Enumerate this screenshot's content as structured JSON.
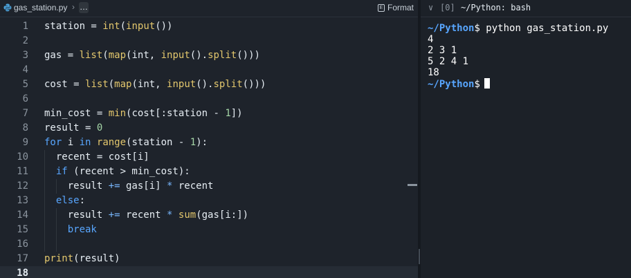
{
  "editor": {
    "tab": {
      "filename": "gas_station.py",
      "separator": "›",
      "more": "…",
      "format_label": "Format"
    },
    "lines": [
      {
        "n": "1",
        "indent": 0,
        "tokens": [
          [
            "",
            "station = "
          ],
          [
            "fn",
            "int"
          ],
          [
            "",
            "("
          ],
          [
            "fn",
            "input"
          ],
          [
            "",
            "())"
          ]
        ]
      },
      {
        "n": "2",
        "indent": 0,
        "tokens": []
      },
      {
        "n": "3",
        "indent": 0,
        "tokens": [
          [
            "",
            "gas = "
          ],
          [
            "fn",
            "list"
          ],
          [
            "",
            "("
          ],
          [
            "fn",
            "map"
          ],
          [
            "",
            "(int, "
          ],
          [
            "fn",
            "input"
          ],
          [
            "",
            "()."
          ],
          [
            "fn",
            "split"
          ],
          [
            "",
            "()))"
          ]
        ]
      },
      {
        "n": "4",
        "indent": 0,
        "tokens": []
      },
      {
        "n": "5",
        "indent": 0,
        "tokens": [
          [
            "",
            "cost = "
          ],
          [
            "fn",
            "list"
          ],
          [
            "",
            "("
          ],
          [
            "fn",
            "map"
          ],
          [
            "",
            "(int, "
          ],
          [
            "fn",
            "input"
          ],
          [
            "",
            "()."
          ],
          [
            "fn",
            "split"
          ],
          [
            "",
            "()))"
          ]
        ]
      },
      {
        "n": "6",
        "indent": 0,
        "tokens": []
      },
      {
        "n": "7",
        "indent": 0,
        "tokens": [
          [
            "",
            "min_cost = "
          ],
          [
            "fn",
            "min"
          ],
          [
            "",
            "(cost[:station - "
          ],
          [
            "num",
            "1"
          ],
          [
            "",
            "])"
          ]
        ]
      },
      {
        "n": "8",
        "indent": 0,
        "tokens": [
          [
            "",
            "result = "
          ],
          [
            "num",
            "0"
          ]
        ]
      },
      {
        "n": "9",
        "indent": 0,
        "tokens": [
          [
            "kw",
            "for"
          ],
          [
            "",
            " i "
          ],
          [
            "kw",
            "in"
          ],
          [
            "",
            " "
          ],
          [
            "fn",
            "range"
          ],
          [
            "",
            "(station - "
          ],
          [
            "num",
            "1"
          ],
          [
            "",
            "):"
          ]
        ]
      },
      {
        "n": "10",
        "indent": 1,
        "tokens": [
          [
            "",
            "  recent = cost[i]"
          ]
        ]
      },
      {
        "n": "11",
        "indent": 1,
        "tokens": [
          [
            "",
            "  "
          ],
          [
            "kw",
            "if"
          ],
          [
            "",
            " (recent > min_cost):"
          ]
        ]
      },
      {
        "n": "12",
        "indent": 2,
        "tokens": [
          [
            "",
            "    result "
          ],
          [
            "op",
            "+="
          ],
          [
            "",
            " gas[i] "
          ],
          [
            "op",
            "*"
          ],
          [
            "",
            " recent"
          ]
        ]
      },
      {
        "n": "13",
        "indent": 1,
        "tokens": [
          [
            "",
            "  "
          ],
          [
            "kw",
            "else"
          ],
          [
            "",
            ":"
          ]
        ]
      },
      {
        "n": "14",
        "indent": 2,
        "tokens": [
          [
            "",
            "    result "
          ],
          [
            "op",
            "+="
          ],
          [
            "",
            " recent "
          ],
          [
            "op",
            "*"
          ],
          [
            "",
            " "
          ],
          [
            "fn",
            "sum"
          ],
          [
            "",
            "(gas[i:])"
          ]
        ]
      },
      {
        "n": "15",
        "indent": 2,
        "tokens": [
          [
            "",
            "    "
          ],
          [
            "kw",
            "break"
          ]
        ]
      },
      {
        "n": "16",
        "indent": 2,
        "tokens": []
      },
      {
        "n": "17",
        "indent": 0,
        "tokens": [
          [
            "fn",
            "print"
          ],
          [
            "",
            "(result)"
          ]
        ]
      },
      {
        "n": "18",
        "indent": 0,
        "tokens": [],
        "active": true
      }
    ]
  },
  "terminal": {
    "header": {
      "chevron": "∨",
      "index": "[0]",
      "title": "~/Python: bash"
    },
    "prompt": "~/Python",
    "command": "$ python gas_station.py",
    "output": [
      "4",
      "2 3 1",
      "5 2 4 1",
      "18"
    ],
    "prompt2": "~/Python",
    "prompt2_suffix": "$"
  },
  "colors": {
    "editor_bg": "#1e232b",
    "function": "#e3c76d",
    "keyword": "#58a6ff",
    "number": "#a5d6a7",
    "prompt": "#58a6ff"
  }
}
